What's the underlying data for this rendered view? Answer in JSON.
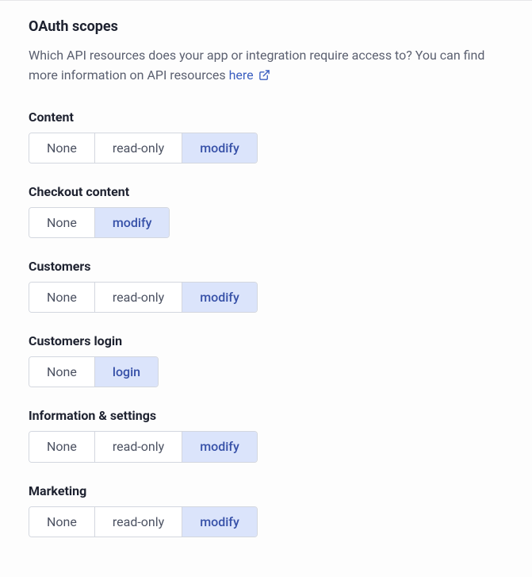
{
  "header": {
    "title": "OAuth scopes",
    "description_prefix": "Which API resources does your app or integration require access to? You can find more information on API resources ",
    "link_label": "here"
  },
  "scopes": [
    {
      "name": "Content",
      "options": [
        {
          "label": "None",
          "active": false
        },
        {
          "label": "read-only",
          "active": false
        },
        {
          "label": "modify",
          "active": true
        }
      ]
    },
    {
      "name": "Checkout content",
      "options": [
        {
          "label": "None",
          "active": false
        },
        {
          "label": "modify",
          "active": true
        }
      ]
    },
    {
      "name": "Customers",
      "options": [
        {
          "label": "None",
          "active": false
        },
        {
          "label": "read-only",
          "active": false
        },
        {
          "label": "modify",
          "active": true
        }
      ]
    },
    {
      "name": "Customers login",
      "options": [
        {
          "label": "None",
          "active": false
        },
        {
          "label": "login",
          "active": true
        }
      ]
    },
    {
      "name": "Information & settings",
      "options": [
        {
          "label": "None",
          "active": false
        },
        {
          "label": "read-only",
          "active": false
        },
        {
          "label": "modify",
          "active": true
        }
      ]
    },
    {
      "name": "Marketing",
      "options": [
        {
          "label": "None",
          "active": false
        },
        {
          "label": "read-only",
          "active": false
        },
        {
          "label": "modify",
          "active": true
        }
      ]
    }
  ]
}
